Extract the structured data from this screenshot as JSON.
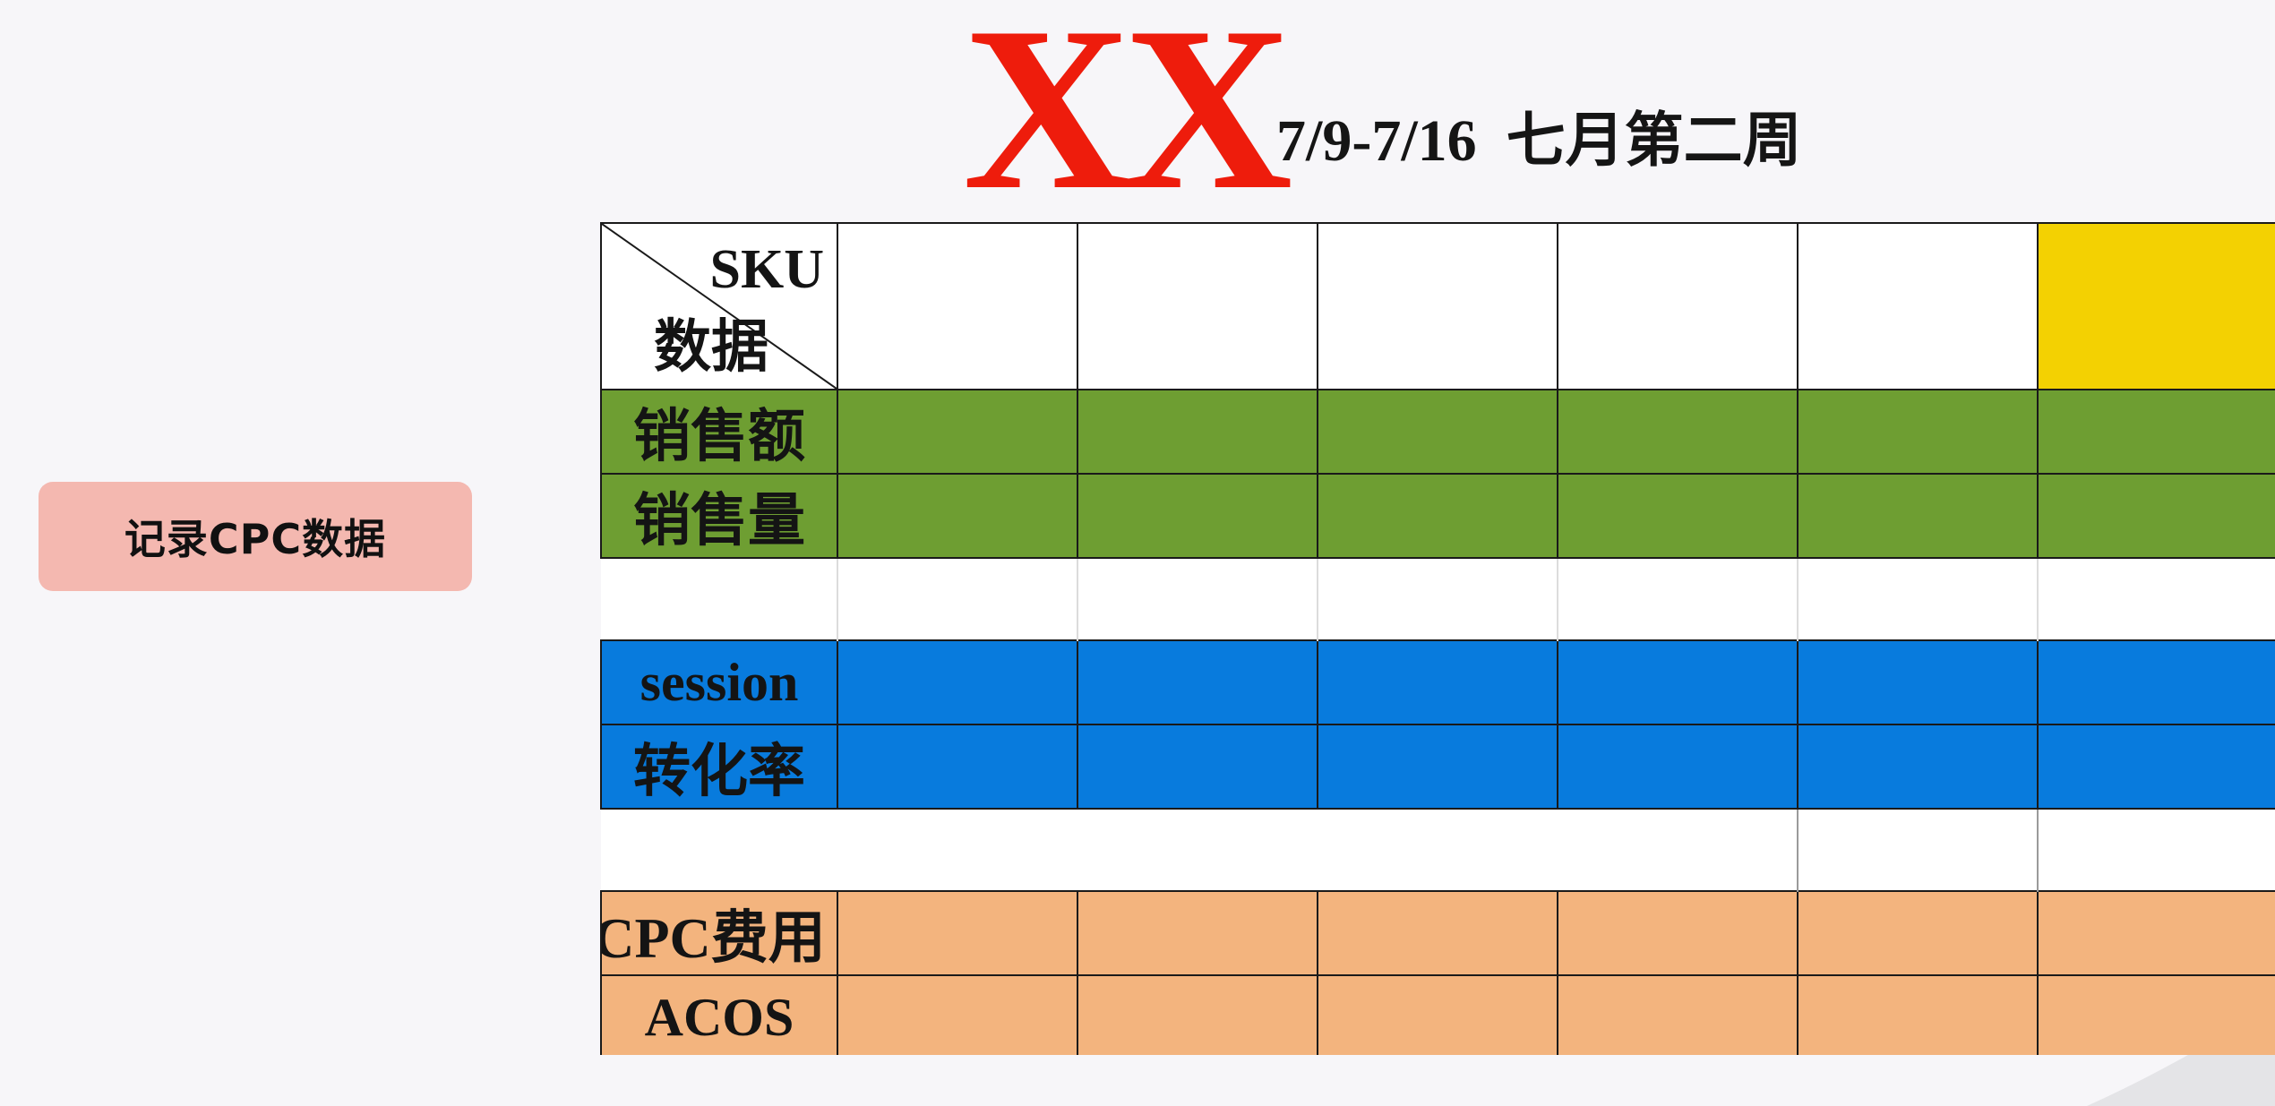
{
  "sidebar": {
    "cpc_button_label": "记录CPC数据"
  },
  "header": {
    "brand": "XX",
    "date_range": "7/9-7/16",
    "week_label": "七月第二周"
  },
  "table": {
    "corner_top": "SKU",
    "corner_bottom": "数据",
    "rows": [
      {
        "label": "销售额",
        "group": "green"
      },
      {
        "label": "销售量",
        "group": "green"
      },
      {
        "label": "session",
        "group": "blue"
      },
      {
        "label": "转化率",
        "group": "blue"
      },
      {
        "label": "CPC费用",
        "group": "orange"
      },
      {
        "label": "ACOS",
        "group": "orange"
      }
    ]
  },
  "colors": {
    "brand_red": "#ee1c0c",
    "green": "#6e9e32",
    "blue": "#087bdd",
    "orange": "#f3b47e",
    "highlight_yellow": "#f3d102",
    "button_pink": "#f4b8b0"
  }
}
